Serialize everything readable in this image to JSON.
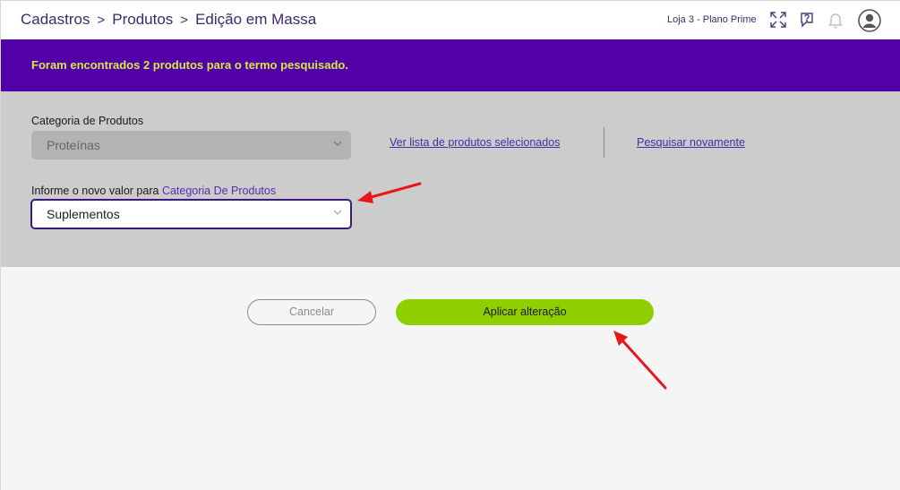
{
  "breadcrumb": {
    "items": [
      "Cadastros",
      "Produtos",
      "Edição em Massa"
    ],
    "separator": ">"
  },
  "header": {
    "store": "Loja 3 - Plano Prime",
    "icons": [
      "expand-icon",
      "help-chat-icon",
      "bell-icon",
      "user-avatar-icon"
    ]
  },
  "banner": {
    "message": "Foram encontrados 2 produtos para o termo pesquisado."
  },
  "form": {
    "category_label": "Categoria de Produtos",
    "category_value": "Proteínas",
    "new_value_label_prefix": "Informe o novo valor para",
    "new_value_label_field": "Categoria De Produtos",
    "new_value": "Suplementos"
  },
  "links": {
    "view_selected": "Ver lista de produtos selecionados",
    "search_again": "Pesquisar novamente"
  },
  "actions": {
    "cancel": "Cancelar",
    "apply": "Aplicar alteração"
  },
  "colors": {
    "banner_bg": "#5200a8",
    "banner_text": "#d7e84a",
    "apply_bg": "#8fcf00",
    "annotation_arrow": "#e8171b"
  }
}
